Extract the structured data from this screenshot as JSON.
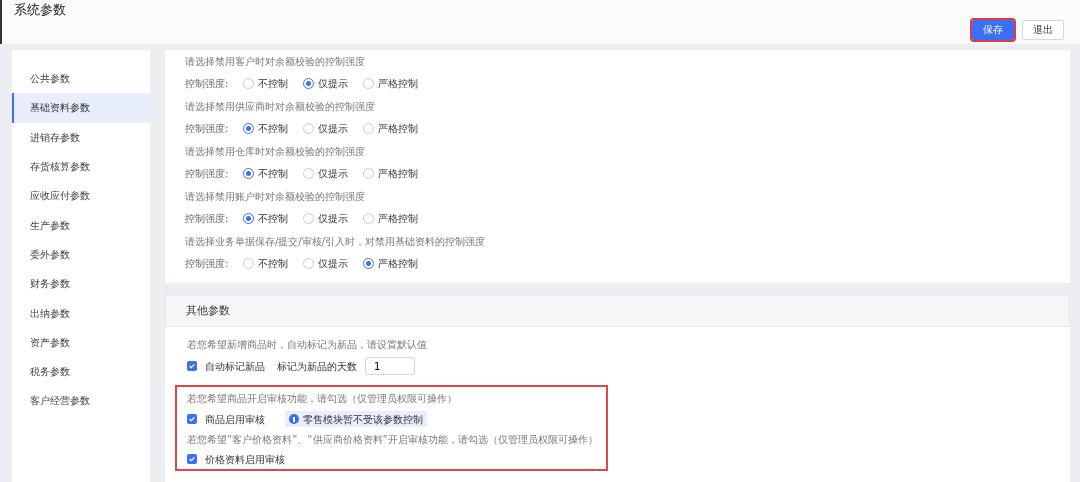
{
  "window": {
    "title": "系统参数"
  },
  "toolbar": {
    "buttons": [
      {
        "label": "保存",
        "kind": "primary",
        "highlighted": true
      },
      {
        "label": "退出",
        "kind": "default",
        "highlighted": false
      }
    ]
  },
  "sidebar": {
    "items": [
      {
        "label": "公共参数",
        "selected": false
      },
      {
        "label": "基础资料参数",
        "selected": true
      },
      {
        "label": "进销存参数",
        "selected": false
      },
      {
        "label": "存货核算参数",
        "selected": false
      },
      {
        "label": "应收应付参数",
        "selected": false
      },
      {
        "label": "生产参数",
        "selected": false
      },
      {
        "label": "委外参数",
        "selected": false
      },
      {
        "label": "财务参数",
        "selected": false
      },
      {
        "label": "出纳参数",
        "selected": false
      },
      {
        "label": "资产参数",
        "selected": false
      },
      {
        "label": "税务参数",
        "selected": false
      },
      {
        "label": "客户经营参数",
        "selected": false
      }
    ]
  },
  "control_settings": [
    {
      "description": "请选择禁用客户时对余额校验的控制强度",
      "label": "控制强度:",
      "options": [
        {
          "label": "不控制",
          "selected": false
        },
        {
          "label": "仅提示",
          "selected": true
        },
        {
          "label": "严格控制",
          "selected": false
        }
      ]
    },
    {
      "description": "请选择禁用供应商时对余额校验的控制强度",
      "label": "控制强度:",
      "options": [
        {
          "label": "不控制",
          "selected": true
        },
        {
          "label": "仅提示",
          "selected": false
        },
        {
          "label": "严格控制",
          "selected": false
        }
      ]
    },
    {
      "description": "请选择禁用仓库时对余额校验的控制强度",
      "label": "控制强度:",
      "options": [
        {
          "label": "不控制",
          "selected": true
        },
        {
          "label": "仅提示",
          "selected": false
        },
        {
          "label": "严格控制",
          "selected": false
        }
      ]
    },
    {
      "description": "请选择禁用账户时对余额校验的控制强度",
      "label": "控制强度:",
      "options": [
        {
          "label": "不控制",
          "selected": true
        },
        {
          "label": "仅提示",
          "selected": false
        },
        {
          "label": "严格控制",
          "selected": false
        }
      ]
    },
    {
      "description": "请选择业务单据保存/提交/审核/引入时，对禁用基础资料的控制强度",
      "label": "控制强度:",
      "options": [
        {
          "label": "不控制",
          "selected": false
        },
        {
          "label": "仅提示",
          "selected": false
        },
        {
          "label": "严格控制",
          "selected": true
        }
      ]
    }
  ],
  "other_section": {
    "title": "其他参数",
    "groups": [
      {
        "description": "若您希望新增商品时，自动标记为新品，请设置默认值",
        "highlighted": false,
        "items": [
          {
            "kind": "checkbox_with_input",
            "label": "自动标记新品",
            "checked": true,
            "input_label": "标记为新品的天数",
            "value": "1"
          }
        ]
      },
      {
        "description": "若您希望商品开启审核功能，请勾选（仅管理员权限可操作）",
        "highlighted": true,
        "items": [
          {
            "kind": "checkbox_with_note",
            "label": "商品启用审核",
            "checked": true,
            "note": "零售模块暂不受该参数控制"
          }
        ],
        "description_2": "若您希望“客户价格资料”、“供应商价格资料”开启审核功能，请勾选（仅管理员权限可操作）",
        "items_2": [
          {
            "kind": "checkbox",
            "label": "价格资料启用审核",
            "checked": true
          }
        ]
      }
    ]
  }
}
